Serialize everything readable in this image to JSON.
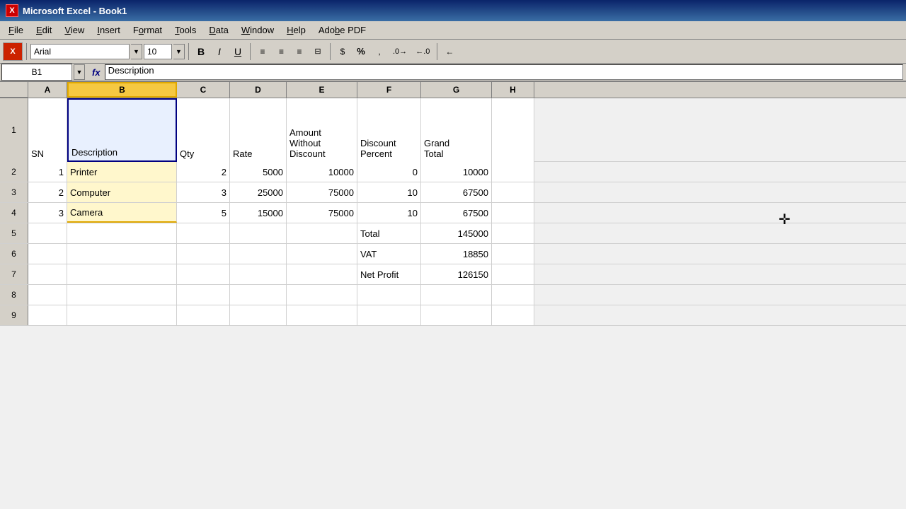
{
  "titleBar": {
    "icon": "X",
    "title": "Microsoft Excel - Book1"
  },
  "menuBar": {
    "items": [
      "File",
      "Edit",
      "View",
      "Insert",
      "Format",
      "Tools",
      "Data",
      "Window",
      "Help",
      "Adobe PDF"
    ]
  },
  "toolbar": {
    "fontName": "Arial",
    "fontSize": "10",
    "boldLabel": "B",
    "italicLabel": "I",
    "underlineLabel": "U",
    "percentLabel": "%",
    "commaLabel": ","
  },
  "formulaBar": {
    "cellRef": "B1",
    "fxLabel": "fx",
    "formula": "Description"
  },
  "columns": {
    "headers": [
      "A",
      "B",
      "C",
      "D",
      "E",
      "F",
      "G",
      "H"
    ],
    "widthClasses": [
      "col-a",
      "col-b",
      "col-c",
      "col-d",
      "col-e",
      "col-f",
      "col-g",
      "col-h"
    ]
  },
  "rows": [
    {
      "rowNum": "1",
      "cells": [
        {
          "value": "SN",
          "align": "left"
        },
        {
          "value": "Description",
          "align": "left",
          "isActive": true
        },
        {
          "value": "Qty",
          "align": "left"
        },
        {
          "value": "Rate",
          "align": "left"
        },
        {
          "value": "Amount\nWithout\nDiscount",
          "align": "left",
          "multiline": true
        },
        {
          "value": "Discount\nPercent",
          "align": "left",
          "multiline": true
        },
        {
          "value": "Grand\nTotal",
          "align": "left",
          "multiline": true
        },
        {
          "value": "",
          "align": "left"
        }
      ]
    },
    {
      "rowNum": "2",
      "cells": [
        {
          "value": "1",
          "align": "right"
        },
        {
          "value": "Printer",
          "align": "left"
        },
        {
          "value": "2",
          "align": "right"
        },
        {
          "value": "5000",
          "align": "right"
        },
        {
          "value": "10000",
          "align": "right"
        },
        {
          "value": "0",
          "align": "right"
        },
        {
          "value": "10000",
          "align": "right"
        },
        {
          "value": "",
          "align": "left"
        }
      ]
    },
    {
      "rowNum": "3",
      "cells": [
        {
          "value": "2",
          "align": "right"
        },
        {
          "value": "Computer",
          "align": "left"
        },
        {
          "value": "3",
          "align": "right"
        },
        {
          "value": "25000",
          "align": "right"
        },
        {
          "value": "75000",
          "align": "right"
        },
        {
          "value": "10",
          "align": "right"
        },
        {
          "value": "67500",
          "align": "right"
        },
        {
          "value": "",
          "align": "left"
        }
      ]
    },
    {
      "rowNum": "4",
      "cells": [
        {
          "value": "3",
          "align": "right"
        },
        {
          "value": "Camera",
          "align": "left"
        },
        {
          "value": "5",
          "align": "right"
        },
        {
          "value": "15000",
          "align": "right"
        },
        {
          "value": "75000",
          "align": "right"
        },
        {
          "value": "10",
          "align": "right"
        },
        {
          "value": "67500",
          "align": "right"
        },
        {
          "value": "",
          "align": "left"
        }
      ]
    },
    {
      "rowNum": "5",
      "cells": [
        {
          "value": "",
          "align": "left"
        },
        {
          "value": "",
          "align": "left"
        },
        {
          "value": "",
          "align": "left"
        },
        {
          "value": "",
          "align": "left"
        },
        {
          "value": "",
          "align": "left"
        },
        {
          "value": "Total",
          "align": "left"
        },
        {
          "value": "145000",
          "align": "right"
        },
        {
          "value": "",
          "align": "left"
        }
      ]
    },
    {
      "rowNum": "6",
      "cells": [
        {
          "value": "",
          "align": "left"
        },
        {
          "value": "",
          "align": "left"
        },
        {
          "value": "",
          "align": "left"
        },
        {
          "value": "",
          "align": "left"
        },
        {
          "value": "",
          "align": "left"
        },
        {
          "value": "VAT",
          "align": "left"
        },
        {
          "value": "18850",
          "align": "right"
        },
        {
          "value": "",
          "align": "left"
        }
      ]
    },
    {
      "rowNum": "7",
      "cells": [
        {
          "value": "",
          "align": "left"
        },
        {
          "value": "",
          "align": "left"
        },
        {
          "value": "",
          "align": "left"
        },
        {
          "value": "",
          "align": "left"
        },
        {
          "value": "",
          "align": "left"
        },
        {
          "value": "Net Profit",
          "align": "left"
        },
        {
          "value": "126150",
          "align": "right"
        },
        {
          "value": "",
          "align": "left"
        }
      ]
    },
    {
      "rowNum": "8",
      "cells": [
        {
          "value": "",
          "align": "left"
        },
        {
          "value": "",
          "align": "left"
        },
        {
          "value": "",
          "align": "left"
        },
        {
          "value": "",
          "align": "left"
        },
        {
          "value": "",
          "align": "left"
        },
        {
          "value": "",
          "align": "left"
        },
        {
          "value": "",
          "align": "left"
        },
        {
          "value": "",
          "align": "left"
        }
      ]
    },
    {
      "rowNum": "9",
      "cells": [
        {
          "value": "",
          "align": "left"
        },
        {
          "value": "",
          "align": "left"
        },
        {
          "value": "",
          "align": "left"
        },
        {
          "value": "",
          "align": "left"
        },
        {
          "value": "",
          "align": "left"
        },
        {
          "value": "",
          "align": "left"
        },
        {
          "value": "",
          "align": "left"
        },
        {
          "value": "",
          "align": "left"
        }
      ]
    }
  ],
  "colors": {
    "titleBarStart": "#0a246a",
    "titleBarEnd": "#3a6ea5",
    "selectedColHeader": "#f5c842",
    "highlightedCell": "#fff7cc",
    "activeCellBorder": "#000080"
  }
}
